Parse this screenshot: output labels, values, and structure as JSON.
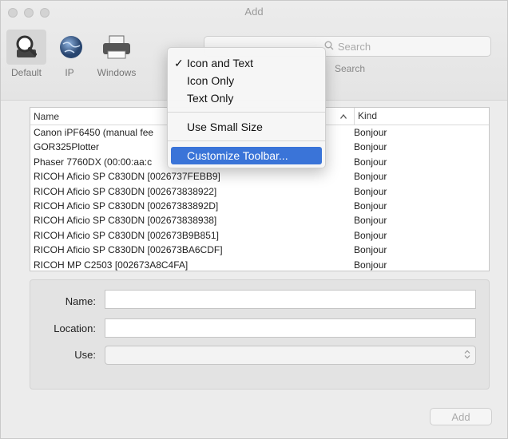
{
  "window": {
    "title": "Add"
  },
  "toolbar": {
    "items": [
      {
        "label": "Default",
        "icon": "printer-default-icon"
      },
      {
        "label": "IP",
        "icon": "globe-icon"
      },
      {
        "label": "Windows",
        "icon": "windows-printer-icon"
      }
    ],
    "search_placeholder": "Search",
    "search_label": "Search"
  },
  "menu": {
    "items": [
      {
        "label": "Icon and Text",
        "checked": true
      },
      {
        "label": "Icon Only"
      },
      {
        "label": "Text Only"
      },
      {
        "label": "Use Small Size"
      },
      {
        "label": "Customize Toolbar...",
        "highlighted": true
      }
    ],
    "check_glyph": "✓"
  },
  "table": {
    "headers": {
      "name": "Name",
      "kind": "Kind",
      "sort_glyph": "^"
    },
    "rows": [
      {
        "name": "Canon iPF6450 (manual fee",
        "kind": "Bonjour"
      },
      {
        "name": "GOR325Plotter",
        "kind": "Bonjour"
      },
      {
        "name": "Phaser 7760DX (00:00:aa:c",
        "kind": "Bonjour"
      },
      {
        "name": "RICOH Aficio SP C830DN [0026737FEBB9]",
        "kind": "Bonjour"
      },
      {
        "name": "RICOH Aficio SP C830DN [002673838922]",
        "kind": "Bonjour"
      },
      {
        "name": "RICOH Aficio SP C830DN [00267383892D]",
        "kind": "Bonjour"
      },
      {
        "name": "RICOH Aficio SP C830DN [002673838938]",
        "kind": "Bonjour"
      },
      {
        "name": "RICOH Aficio SP C830DN [002673B9B851]",
        "kind": "Bonjour"
      },
      {
        "name": "RICOH Aficio SP C830DN [002673BA6CDF]",
        "kind": "Bonjour"
      },
      {
        "name": "RICOH MP C2503 [002673A8C4FA]",
        "kind": "Bonjour"
      }
    ]
  },
  "form": {
    "name_label": "Name:",
    "name_value": "",
    "location_label": "Location:",
    "location_value": "",
    "use_label": "Use:",
    "use_value": ""
  },
  "buttons": {
    "add": "Add"
  },
  "colors": {
    "highlight": "#3a74d8"
  }
}
